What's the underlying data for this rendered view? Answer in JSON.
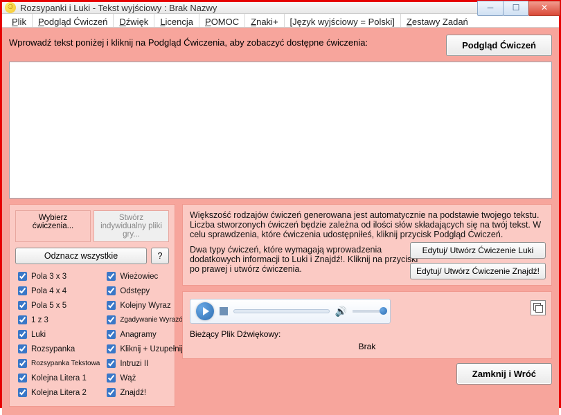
{
  "title": "Rozsypanki i Luki - Tekst wyjściowy : Brak Nazwy",
  "menu": [
    "Plik",
    "Podgląd Ćwiczeń",
    "Dźwięk",
    "Licencja",
    "POMOC",
    "Znaki+",
    "[Język wyjściowy = Polski]",
    "Zestawy Zadań"
  ],
  "instruction": "Wprowadź tekst poniżej i kliknij na Podgląd Ćwiczenia, aby zobaczyć dostępne ćwiczenia:",
  "preview_btn": "Podgląd Ćwiczeń",
  "textarea_value": "",
  "tabs": {
    "active": "Wybierz ćwiczenia...",
    "inactive": "Stwórz indywidualny pliki gry..."
  },
  "deselect_btn": "Odznacz wszystkie",
  "help_btn": "?",
  "checks_left": [
    {
      "label": "Pola 3 x 3",
      "small": false
    },
    {
      "label": "Pola 4 x 4",
      "small": false
    },
    {
      "label": "Pola 5 x 5",
      "small": false
    },
    {
      "label": "1 z 3",
      "small": false
    },
    {
      "label": "Luki",
      "small": false
    },
    {
      "label": "Rozsypanka",
      "small": false
    },
    {
      "label": "Rozsypanka Tekstowa",
      "small": true
    },
    {
      "label": "Kolejna Litera 1",
      "small": false
    },
    {
      "label": "Kolejna Litera 2",
      "small": false
    }
  ],
  "checks_right": [
    {
      "label": "Wieżowiec",
      "small": false
    },
    {
      "label": "Odstępy",
      "small": false
    },
    {
      "label": "Kolejny Wyraz",
      "small": false
    },
    {
      "label": "Zgadywanie Wyrazów",
      "small": true
    },
    {
      "label": "Anagramy",
      "small": false
    },
    {
      "label": "Kliknij + Uzupełnij",
      "small": false
    },
    {
      "label": "Intruzi II",
      "small": false
    },
    {
      "label": "Wąż",
      "small": false
    },
    {
      "label": "Znajdź!",
      "small": false
    }
  ],
  "info": {
    "p1": "Większość rodzajów ćwiczeń generowana jest automatycznie na podstawie twojego tekstu. Liczba stworzonych ćwiczeń będzie zależna od ilości słów składających się na twój tekst. W celu sprawdzenia, które ćwiczenia udostępniłeś, kliknij przycisk Podgląd Ćwiczeń.",
    "p2": "Dwa typy ćwiczeń, które wymagają wprowadzenia dodatkowych informacji to Luki i Znajdź!. Kliknij na przyciski po prawej i utwórz ćwiczenia.",
    "btn1": "Edytuj/ Utwórz Ćwiczenie Luki",
    "btn2": "Edytuj/ Utwórz Ćwiczenie Znajdź!"
  },
  "audio": {
    "label": "Bieżący Plik Dźwiękowy:",
    "value": "Brak"
  },
  "close_btn": "Zamknij i Wróć"
}
